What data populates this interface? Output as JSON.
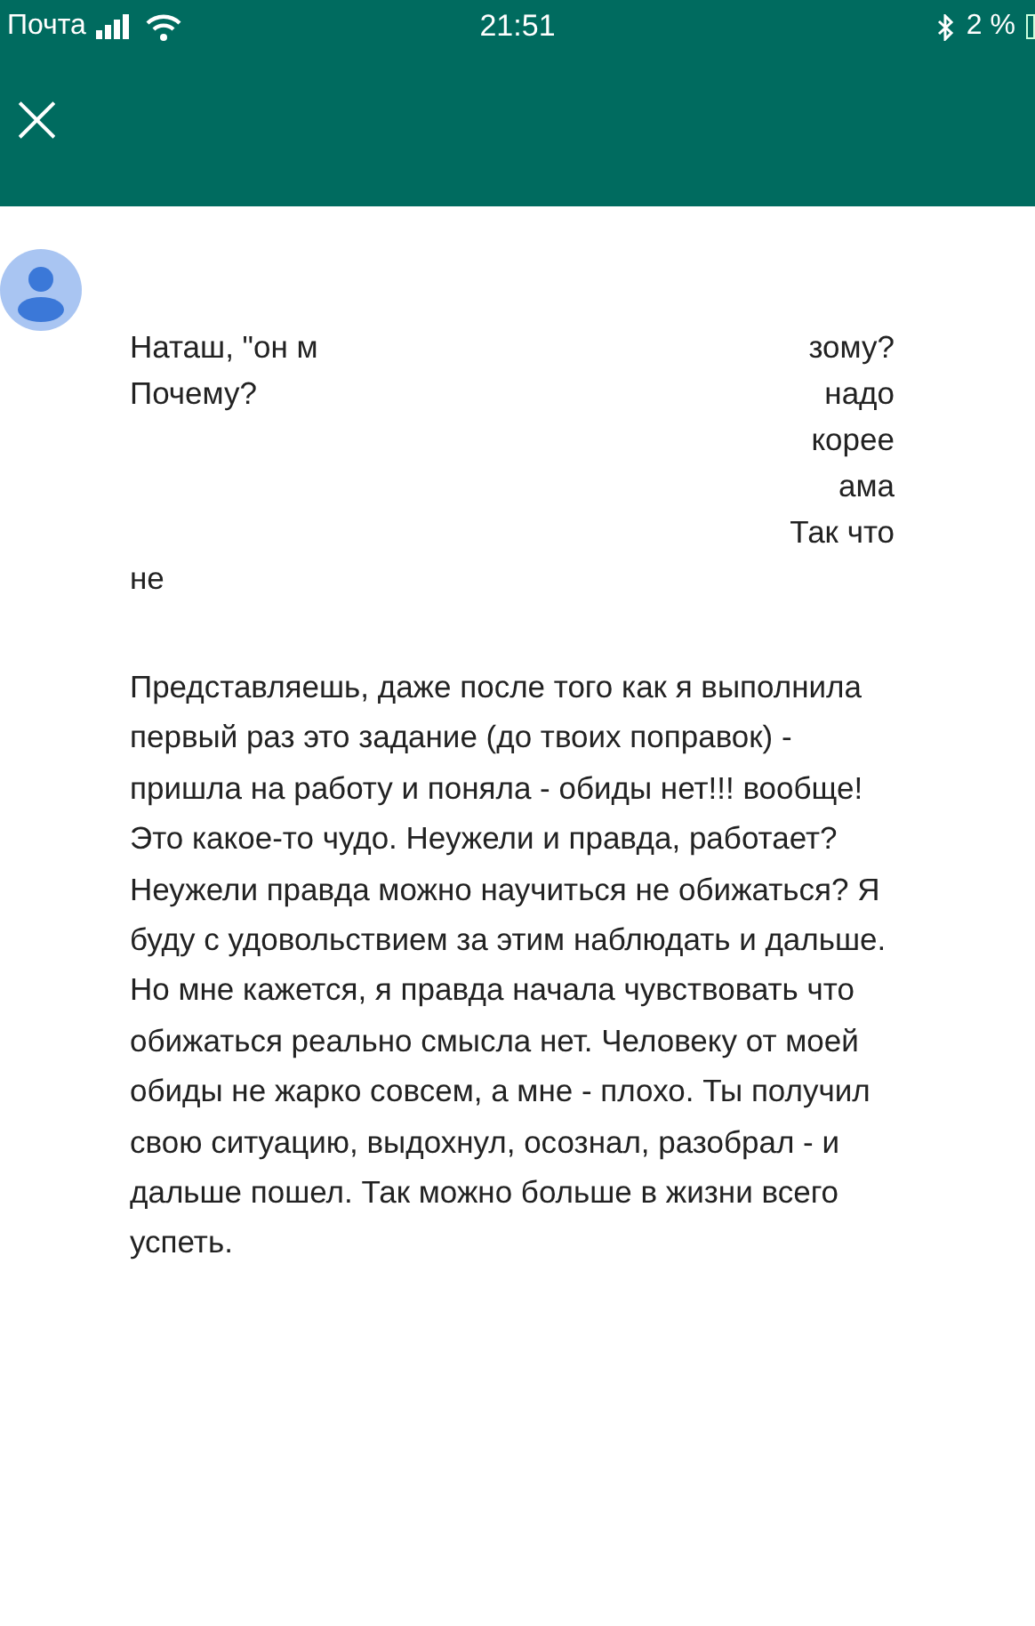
{
  "status_bar": {
    "carrier": "Почта",
    "time": "21:51",
    "battery": "2 %"
  },
  "header": {
    "close": "×"
  },
  "message": {
    "redacted_lines": [
      {
        "left": "Наташ, \"он м",
        "right": "зому?"
      },
      {
        "left": "Почему?",
        "right": "надо"
      },
      {
        "right": "корее"
      },
      {
        "right": "ама"
      },
      {
        "right": "Так что"
      },
      {
        "left": "не"
      }
    ],
    "paragraph": "Представляешь, даже после того как я выполнила первый раз это задание (до твоих поправок) - пришла на работу и поняла - обиды нет!!! вообще! Это какое-то чудо. Неужели и правда, работает? Неужели правда можно научиться не обижаться? Я буду с удовольствием за этим наблюдать и дальше. Но мне кажется, я правда начала чувствовать что обижаться реально смысла нет. Человеку от моей обиды не жарко совсем, а мне - плохо. Ты получил свою ситуацию, выдохнул, осознал, разобрал - и дальше пошел. Так можно больше в жизни всего успеть."
  }
}
